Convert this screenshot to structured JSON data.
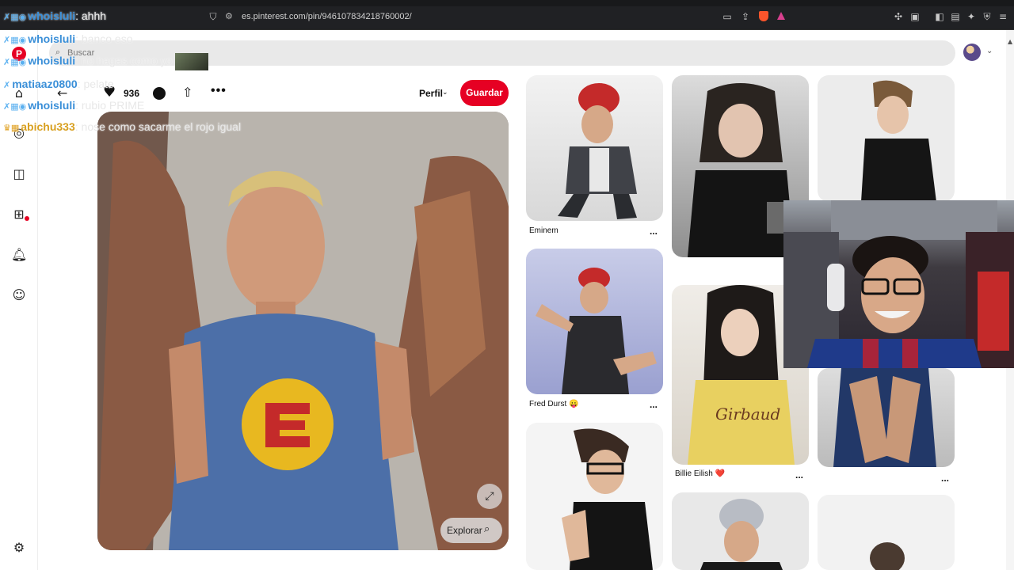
{
  "browser": {
    "tab_title": "whoisluli: ahhh",
    "url": "es.pinterest.com/pin/946107834218760002/",
    "colors": {
      "chrome_bg": "#202124",
      "brave": "#fb542b"
    }
  },
  "pinterest": {
    "search_placeholder": "Buscar",
    "pin": {
      "likes": "936",
      "profile_label": "Perfil",
      "save_label": "Guardar",
      "explore_label": "Explorar"
    },
    "grid": [
      {
        "label": "Eminem",
        "more": "..."
      },
      {
        "label": "Fred Durst 😛",
        "more": "..."
      },
      {
        "label": "Billie Eilish ❤️",
        "more": "..."
      },
      {
        "label": "",
        "more": "..."
      }
    ],
    "colors": {
      "accent": "#e60023",
      "search_bg": "#e9e9e9"
    }
  },
  "chat": [
    {
      "user": "whoisluli",
      "message": "ahhh",
      "user_color": "#3a8fd8"
    },
    {
      "user": "whoisluli",
      "message": "banco eso",
      "user_color": "#3a8fd8"
    },
    {
      "user": "whoisluli",
      "message": "no hagas como yo",
      "user_color": "#3a8fd8"
    },
    {
      "user": "matiaaz0800",
      "message": "pelate",
      "user_color": "#3a8fd8"
    },
    {
      "user": "whoisluli",
      "message": "rubio PRIME",
      "user_color": "#3a8fd8"
    },
    {
      "user": "abichu333",
      "message": "nose como sacarme el rojo igual",
      "user_color": "#d8a020"
    }
  ]
}
